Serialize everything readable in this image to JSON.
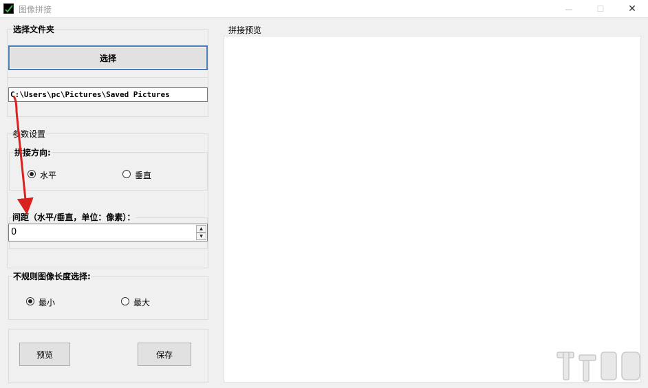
{
  "window": {
    "title": "图像拼接",
    "minimize_glyph": "—",
    "maximize_glyph": "☐",
    "close_glyph": "✕"
  },
  "folder_group": {
    "label": "选择文件夹",
    "select_button_label": "选择",
    "path_value": "C:\\Users\\pc\\Pictures\\Saved Pictures"
  },
  "params_group": {
    "label": "参数设置",
    "direction": {
      "label": "拼接方向:",
      "options": [
        {
          "label": "水平",
          "checked": true
        },
        {
          "label": "垂直",
          "checked": false
        }
      ]
    },
    "spacing": {
      "label": "间距（水平/垂直，单位：像素）：",
      "value": "0",
      "up_glyph": "▲",
      "down_glyph": "▼"
    }
  },
  "irregular_group": {
    "label": "不规则图像长度选择:",
    "options": [
      {
        "label": "最小",
        "checked": true
      },
      {
        "label": "最大",
        "checked": false
      }
    ]
  },
  "actions": {
    "preview_label": "预览",
    "save_label": "保存"
  },
  "preview_panel": {
    "label": "拼接预览"
  },
  "icons": {
    "app": "checkmark-icon",
    "annotation": "red-arrow-icon",
    "watermark": "site-logo"
  },
  "colors": {
    "focus_border": "#4a7db8",
    "annotation_arrow": "#d9211f",
    "app_icon_check": "#39b54a"
  }
}
